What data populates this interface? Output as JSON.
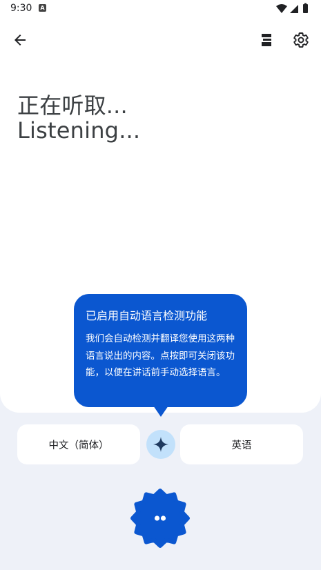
{
  "status_bar": {
    "time": "9:30",
    "notification_badge": "A",
    "icons": [
      "wifi-icon",
      "signal-icon",
      "battery-icon"
    ]
  },
  "toolbar": {
    "back_icon": "arrow-back-icon",
    "layout_icon": "split-view-icon",
    "settings_icon": "gear-icon"
  },
  "transcript": {
    "source_text": "正在听取...",
    "target_text": "Listening..."
  },
  "tooltip": {
    "title": "已启用自动语言检测功能",
    "body": "我们会自动检测并翻译您使用这两种语言说出的内容。点按即可关闭该功能，以便在讲话前手动选择语言。"
  },
  "languages": {
    "source": "中文（简体）",
    "target": "英语",
    "swap_icon": "sparkle-icon"
  },
  "mic": {
    "icon": "listening-dots-icon"
  },
  "colors": {
    "accent": "#0b57d0",
    "swap_bg": "#c2e1fb",
    "background": "#eef1f8"
  }
}
